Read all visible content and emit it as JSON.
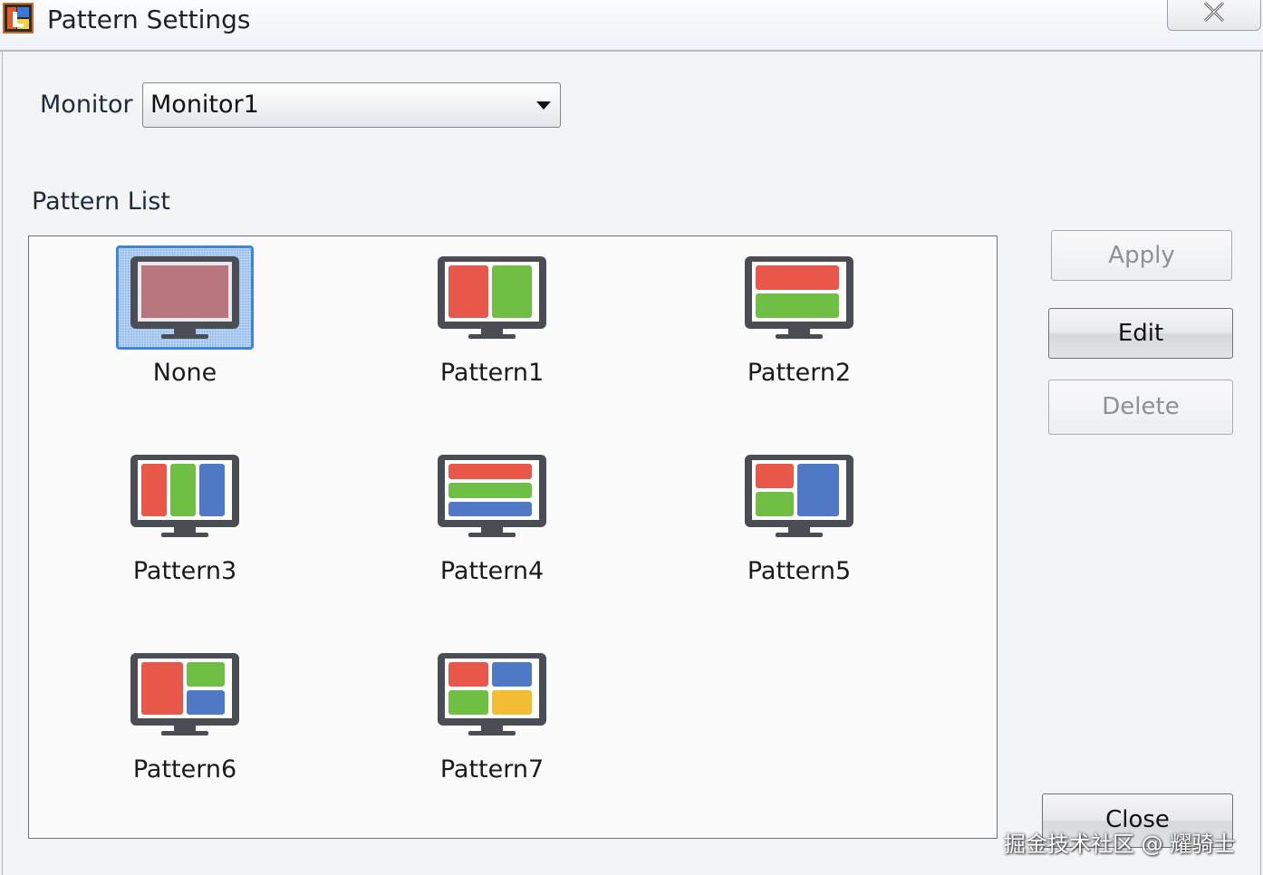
{
  "window": {
    "title": "Pattern Settings",
    "app_icon": "app-logo-icon",
    "close_icon": "close-icon"
  },
  "monitor": {
    "label": "Monitor",
    "selected": "Monitor1"
  },
  "pattern_list": {
    "label": "Pattern List",
    "selected_index": 0,
    "items": [
      {
        "label": "None",
        "icon": "pattern-none-icon"
      },
      {
        "label": "Pattern1",
        "icon": "pattern-1-icon"
      },
      {
        "label": "Pattern2",
        "icon": "pattern-2-icon"
      },
      {
        "label": "Pattern3",
        "icon": "pattern-3-icon"
      },
      {
        "label": "Pattern4",
        "icon": "pattern-4-icon"
      },
      {
        "label": "Pattern5",
        "icon": "pattern-5-icon"
      },
      {
        "label": "Pattern6",
        "icon": "pattern-6-icon"
      },
      {
        "label": "Pattern7",
        "icon": "pattern-7-icon"
      }
    ]
  },
  "buttons": {
    "apply": "Apply",
    "edit": "Edit",
    "delete": "Delete",
    "close": "Close"
  },
  "watermark": "掘金技术社区 @ 耀骑士",
  "colors": {
    "red": "#e8574a",
    "green": "#6fbf45",
    "blue": "#4f79c4",
    "yellow": "#f2bd32",
    "selection": "#3d85d6"
  }
}
